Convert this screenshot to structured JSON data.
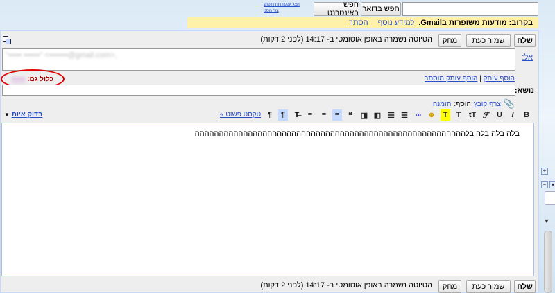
{
  "search": {
    "input_value": "",
    "mail_button": "חפש בדואר",
    "web_button": "חפש באינטרנט",
    "show_options": "הצג אפשרויות חיפוש",
    "create_filter": "צור מסנן"
  },
  "notice": {
    "text": "בקרוב: מודעות משופרות בGmail.",
    "learn_more": "למידע נוסף",
    "hide": "הסתר"
  },
  "top_bar": {
    "send": "שלח",
    "save_now": "שמור כעת",
    "discard": "מחק",
    "autosave": "הטיוטה נשמרה באופן אוטומטי ב- 14:17 (לפני 2 דקות)"
  },
  "bottom_bar": {
    "send": "שלח",
    "save_now": "שמור כעת",
    "discard": "מחק",
    "autosave": "הטיוטה נשמרה באופן אוטומטי ב- 14:17 (לפני 2 דקות)"
  },
  "to": {
    "label": "אל:",
    "value": "\"••••• ••••••\" <•••••••@gmail.com>,"
  },
  "links": {
    "add_cc": "הוסף עותק",
    "separator": "|",
    "add_bcc": "הוסף עותק מוסתר",
    "include_label": "כלול גם:",
    "include_value": "•••••"
  },
  "subject": {
    "label": "נושא:",
    "value": "."
  },
  "attach": {
    "attach_file": "צרף קובץ",
    "add_label": "הוסף:",
    "invitation": "הזמנה"
  },
  "toolbar": {
    "plain_text": "טקסט פשוט »",
    "spell_check": "בדוק איות",
    "spell_arrow": "▼"
  },
  "body": {
    "text": "בלה בלה בלה בלהההההההההההההההההההההההההההההההההההההההההההההההההההההההה"
  },
  "colors": {
    "notice_bg": "#fff1a8",
    "highlight": "#e00000",
    "link": "#2a4ec8"
  }
}
